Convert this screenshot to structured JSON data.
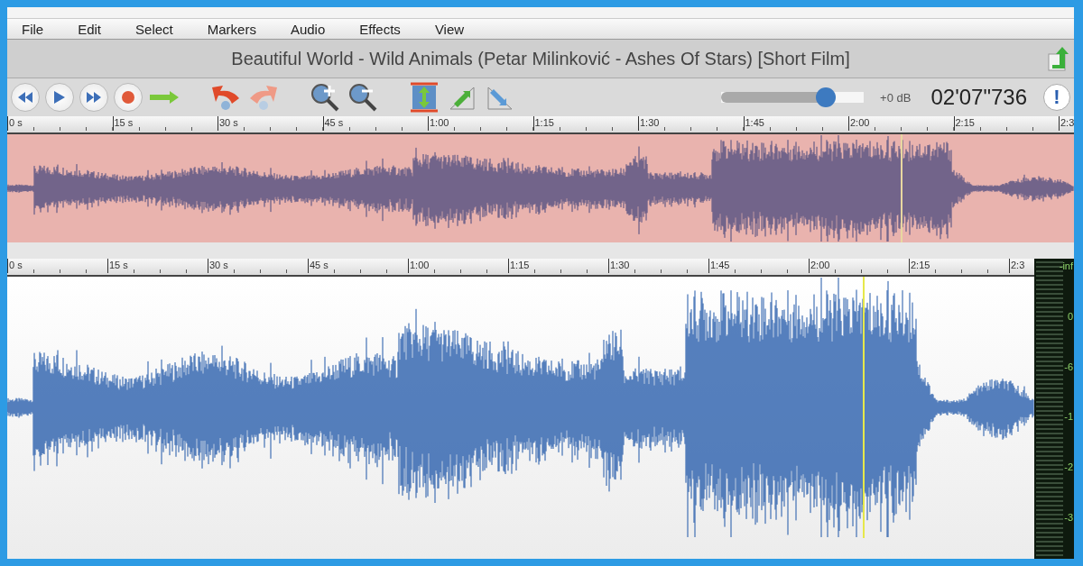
{
  "menu": [
    "File",
    "Edit",
    "Select",
    "Markers",
    "Audio",
    "Effects",
    "View"
  ],
  "title": "Beautiful World - Wild Animals (Petar Milinković - Ashes Of Stars) [Short Film]",
  "volume": {
    "level": 0.77,
    "reading": "+0 dB"
  },
  "time": "02'07\"736",
  "info": "!",
  "overview_ruler": [
    "0 s",
    "15 s",
    "30 s",
    "45 s",
    "1:00",
    "1:15",
    "1:30",
    "1:45",
    "2:00",
    "2:15",
    "2:3"
  ],
  "main_ruler": [
    "0 s",
    "15 s",
    "30 s",
    "45 s",
    "1:00",
    "1:15",
    "1:30",
    "1:45",
    "2:00",
    "2:15",
    "2:3"
  ],
  "meter_labels": [
    "-inf",
    "0",
    "-6",
    "-1",
    "-2",
    "-3"
  ]
}
